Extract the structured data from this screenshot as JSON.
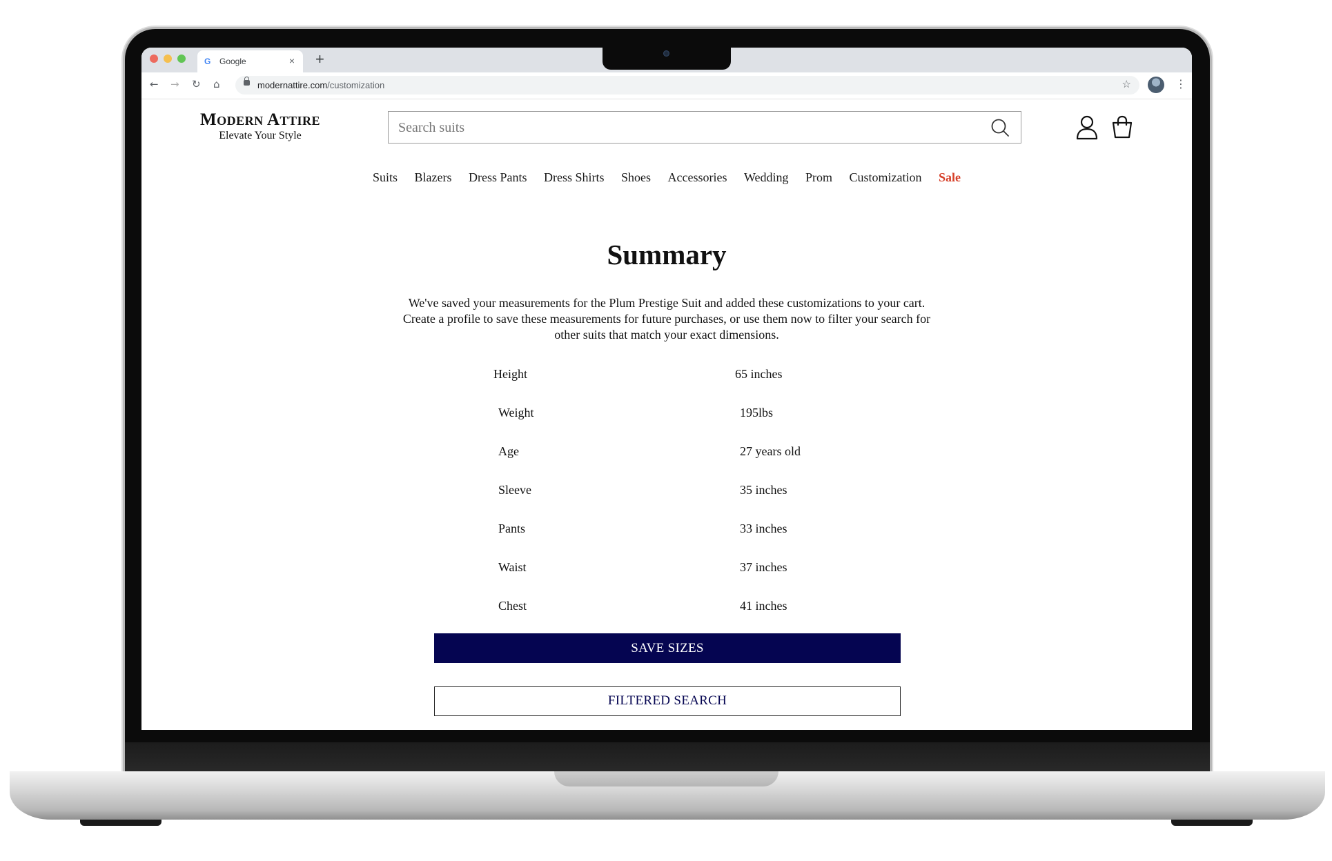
{
  "browser": {
    "tab_title": "Google",
    "tab_icon": "G",
    "new_tab_label": "+",
    "tab_close_label": "×",
    "url_domain": "modernattire.com",
    "url_path": "/customization"
  },
  "site": {
    "brand_name": "Modern Attire",
    "tagline": "Elevate Your Style",
    "search_placeholder": "Search suits",
    "nav": [
      "Suits",
      "Blazers",
      "Dress Pants",
      "Dress Shirts",
      "Shoes",
      "Accessories",
      "Wedding",
      "Prom",
      "Customization",
      "Sale"
    ],
    "sale_color": "#d6402a"
  },
  "summary": {
    "title": "Summary",
    "description": "We've saved your measurements for the Plum Prestige Suit and added these customizations to your cart. Create a profile to save these measurements for future purchases, or use them now to filter your search for other suits that match your exact dimensions.",
    "measurements": [
      {
        "label": "Height",
        "value": "65 inches"
      },
      {
        "label": "Weight",
        "value": "195lbs"
      },
      {
        "label": "Age",
        "value": "27 years old"
      },
      {
        "label": "Sleeve",
        "value": "35 inches"
      },
      {
        "label": "Pants",
        "value": "33 inches"
      },
      {
        "label": "Waist",
        "value": "37 inches"
      },
      {
        "label": "Chest",
        "value": "41 inches"
      }
    ],
    "save_button": "SAVE SIZES",
    "filter_button": "FILTERED SEARCH",
    "primary_color": "#050551"
  }
}
